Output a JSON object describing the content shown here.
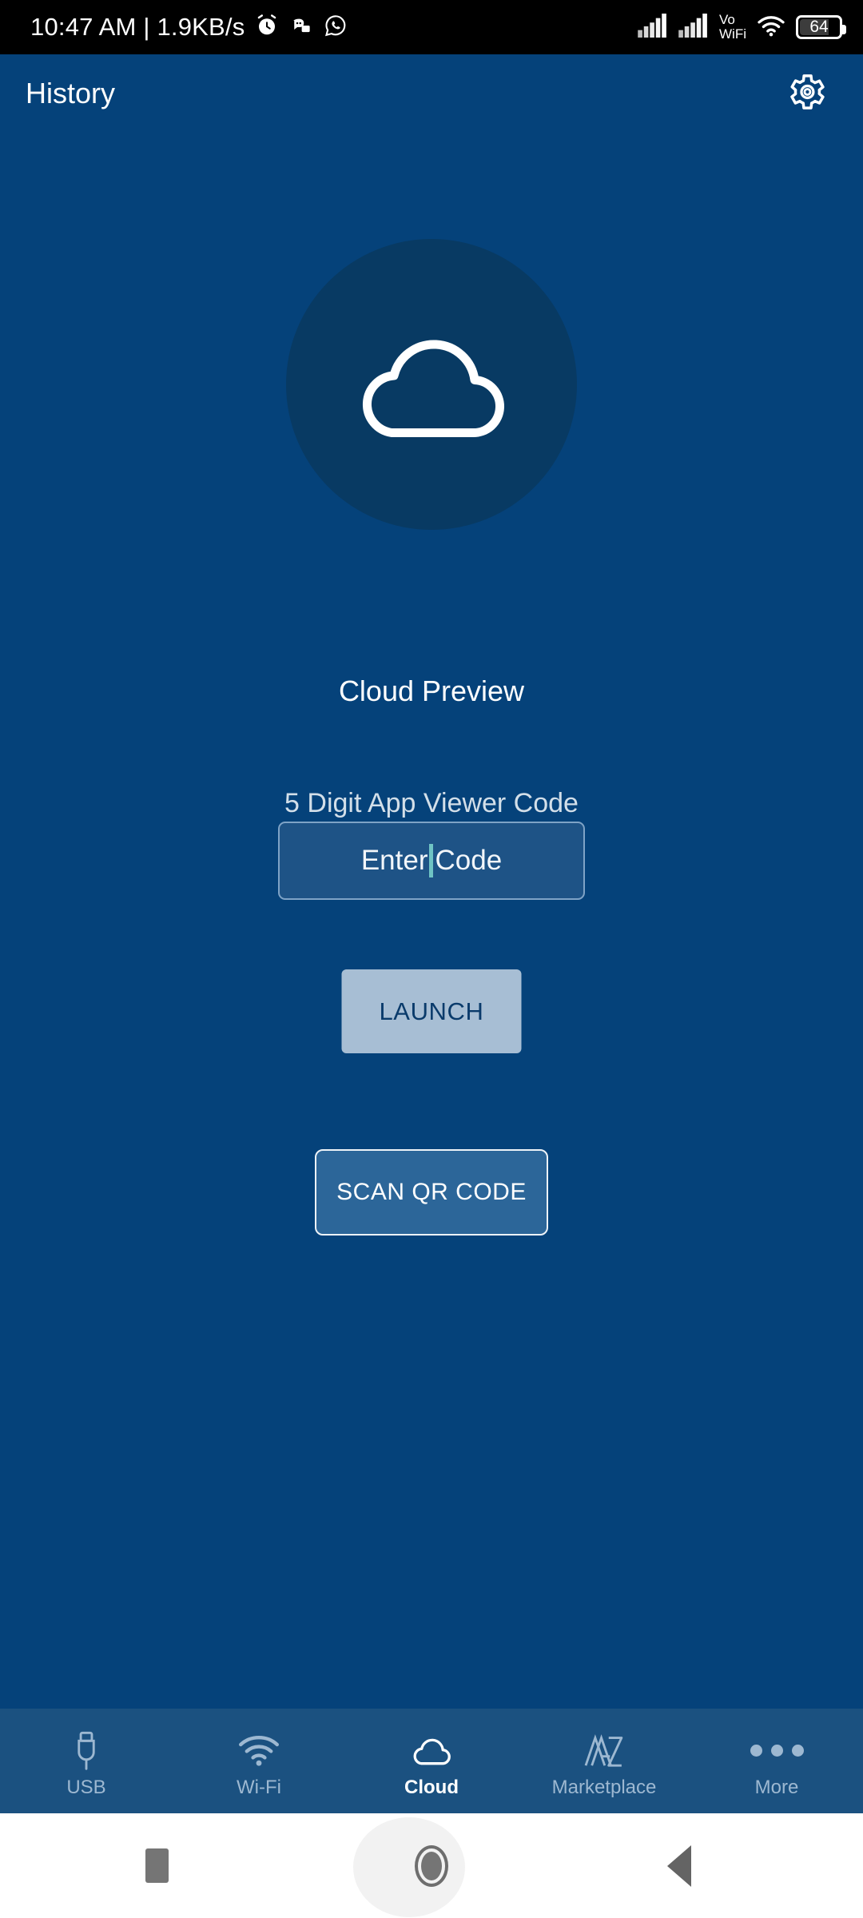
{
  "statusbar": {
    "clock": "10:47 AM | 1.9KB/s",
    "notification_icons": [
      "alarm-clock-icon",
      "discord-icon",
      "whatsapp-icon"
    ],
    "signal_1": "signal-bars-icon",
    "signal_2": "signal-bars-icon",
    "volte_line1": "Vo",
    "volte_line2": "WiFi",
    "wifi": "wifi-icon",
    "battery_level": "64"
  },
  "appbar": {
    "title": "History",
    "settings_icon": "gear-icon"
  },
  "main": {
    "logo_icon": "cloud-icon",
    "preview_title": "Cloud Preview",
    "code_label": "5 Digit App Viewer Code",
    "code_input": {
      "value": "",
      "placeholder_left": "Enter",
      "placeholder_right": "Code"
    },
    "launch_label": "LAUNCH",
    "scan_label": "SCAN QR CODE"
  },
  "tabbar": {
    "items": [
      {
        "label": "USB",
        "icon": "usb-icon",
        "active": false
      },
      {
        "label": "Wi-Fi",
        "icon": "wifi-icon",
        "active": false
      },
      {
        "label": "Cloud",
        "icon": "cloud-icon",
        "active": true
      },
      {
        "label": "Marketplace",
        "icon": "marketplace-icon",
        "active": false
      },
      {
        "label": "More",
        "icon": "more-dots-icon",
        "active": false
      }
    ]
  },
  "sysnav": {
    "recents": "recents-square-icon",
    "home": "home-circle-icon",
    "back": "back-triangle-icon"
  },
  "colors": {
    "background": "#05427a",
    "tabbar": "#1b5180",
    "logo_circle": "#083a63",
    "input_fill": "#1e5386",
    "launch_fill": "#a7bed4",
    "scan_fill": "#2c6699",
    "caret": "#6fc4c4",
    "accent_text": "#ffffff",
    "muted_text": "#9db8d1"
  }
}
